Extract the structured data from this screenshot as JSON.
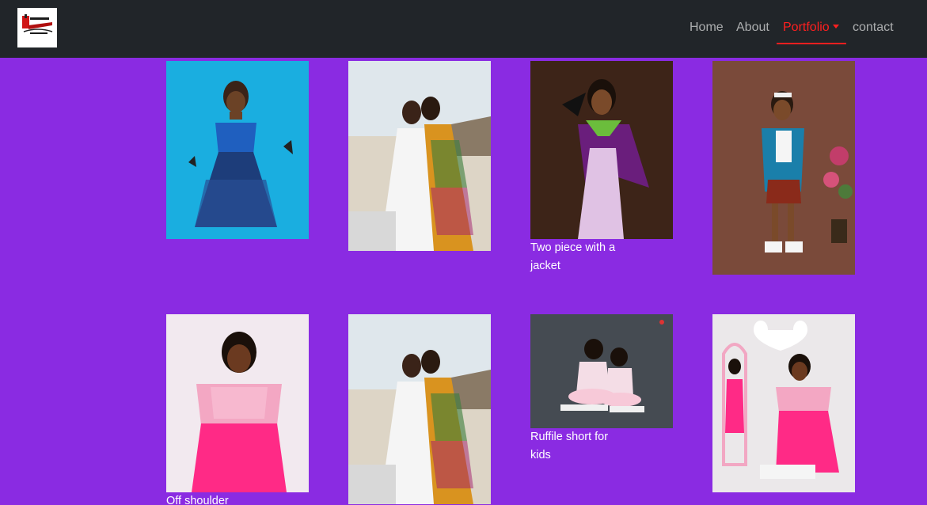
{
  "navbar": {
    "logo_name": "brand-logo",
    "links": [
      {
        "label": "Home"
      },
      {
        "label": "About"
      },
      {
        "label": "Portfolio"
      },
      {
        "label": "contact"
      }
    ],
    "active_link": "Portfolio"
  },
  "gallery": {
    "items": [
      {
        "caption": "",
        "photo": "girl-blue-dress-with-butterflies"
      },
      {
        "caption": "",
        "photo": "two-women-at-beach"
      },
      {
        "caption": "Two piece with a jacket",
        "photo": "woman-graduation-gown"
      },
      {
        "caption": "",
        "photo": "girl-ankara-outfit"
      },
      {
        "caption": "Off shoulder",
        "photo": "woman-pink-off-shoulder"
      },
      {
        "caption": "",
        "photo": "two-women-at-beach"
      },
      {
        "caption": "Ruffile short for kids",
        "photo": "two-girls-pink-outfits"
      },
      {
        "caption": "",
        "photo": "woman-mirror-pink-dress"
      }
    ]
  },
  "colors": {
    "navbar_bg": "#212529",
    "page_bg": "#8a2be2",
    "active_link": "#ff1f1f",
    "link": "#a9aaac",
    "caption_text": "#ffffff"
  }
}
